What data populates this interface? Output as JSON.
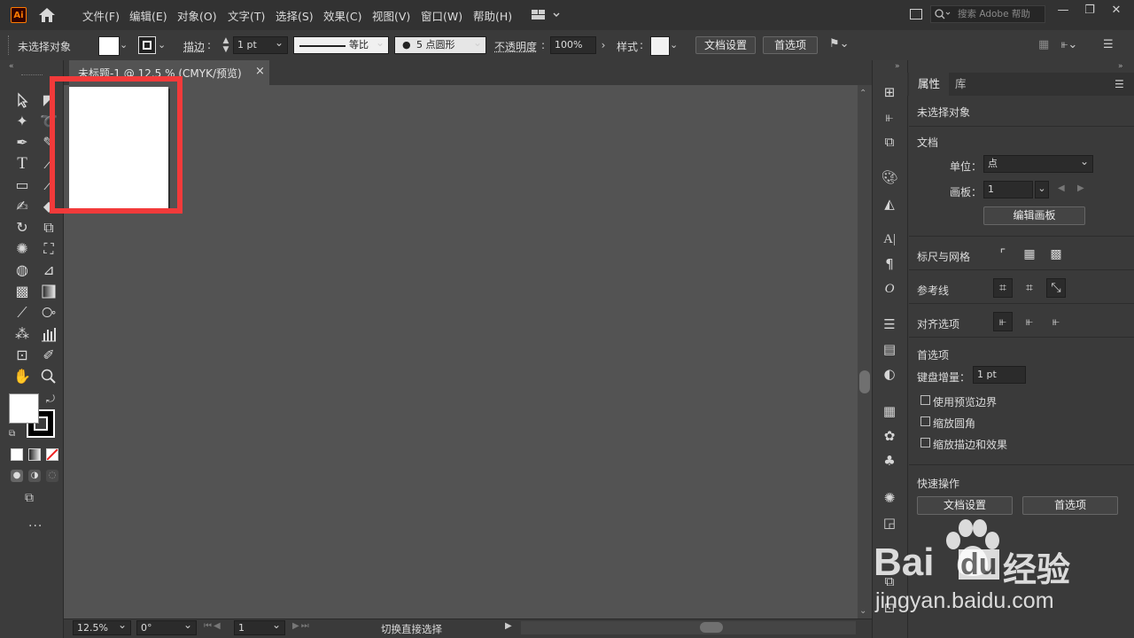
{
  "menubar": {
    "logo": "Ai",
    "items": [
      "文件(F)",
      "编辑(E)",
      "对象(O)",
      "文字(T)",
      "选择(S)",
      "效果(C)",
      "视图(V)",
      "窗口(W)",
      "帮助(H)"
    ],
    "search_placeholder": "搜索 Adobe 帮助"
  },
  "control": {
    "selection_status": "未选择对象",
    "stroke_label": "描边",
    "stroke_value": "1 pt",
    "profile_label": "等比",
    "brush_value": "5 点圆形",
    "opacity_label": "不透明度",
    "opacity_value": "100%",
    "style_label": "样式",
    "doc_setup_button": "文档设置",
    "prefs_button": "首选项"
  },
  "document": {
    "tab_title": "未标题-1 @ 12.5 % (CMYK/预览)",
    "close_glyph": "×"
  },
  "status": {
    "zoom": "12.5%",
    "rotation": "0°",
    "artboard": "1",
    "message": "切换直接选择"
  },
  "panel": {
    "tabs": [
      "属性",
      "库"
    ],
    "no_selection": "未选择对象",
    "document_header": "文档",
    "units_label": "单位：",
    "units_value": "点",
    "artboard_label": "画板：",
    "artboard_value": "1",
    "edit_artboards_button": "编辑画板",
    "rulers_grids_label": "标尺与网格",
    "guides_label": "参考线",
    "snap_options_label": "对齐选项",
    "prefs_header": "首选项",
    "keyboard_increment_label": "键盘增量：",
    "keyboard_increment_value": "1 pt",
    "checkboxes": [
      "使用预览边界",
      "缩放圆角",
      "缩放描边和效果"
    ],
    "quick_actions_header": "快速操作",
    "quick_doc_setup": "文档设置",
    "quick_prefs": "首选项"
  },
  "watermark": {
    "brand_bai": "Bai",
    "brand_du": "du",
    "brand_cn": "经验",
    "url": "jingyan.baidu.com"
  },
  "colors": {
    "accent_red": "#f23a3a",
    "canvas": "#535353",
    "chrome": "#323232"
  }
}
